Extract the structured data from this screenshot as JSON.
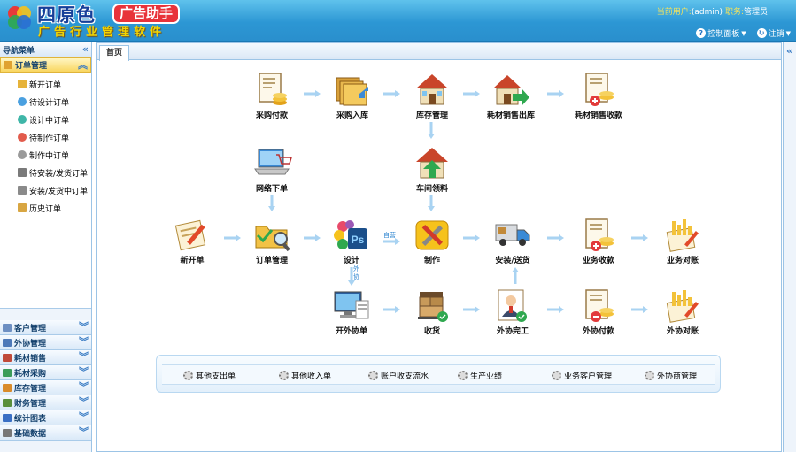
{
  "brand": {
    "main": "四原色",
    "badge": "广告助手",
    "sub": "广告行业管理软件"
  },
  "user": {
    "current_label": "当前用户:",
    "current_value": "(admin)",
    "role_label": "职务:",
    "role_value": "管理员"
  },
  "top_nav": {
    "control_panel": "控制面板",
    "logout": "注销"
  },
  "sidebar": {
    "title": "导航菜单",
    "active_group": "订单管理",
    "order_items": [
      "新开订单",
      "待设计订单",
      "设计中订单",
      "待制作订单",
      "制作中订单",
      "待安装/发货订单",
      "安装/发货中订单",
      "历史订单"
    ],
    "groups": [
      "客户管理",
      "外协管理",
      "耗材销售",
      "耗材采购",
      "库存管理",
      "财务管理",
      "统计图表",
      "基础数据"
    ]
  },
  "tabs": {
    "home": "首页"
  },
  "flow": {
    "purchase_pay": "采购付款",
    "purchase_in": "采购入库",
    "inventory": "库存管理",
    "consumable_out": "耗材销售出库",
    "consumable_collect": "耗材销售收款",
    "online_order": "网络下单",
    "workshop_material": "车间领料",
    "new_order": "新开单",
    "order_mgmt": "订单管理",
    "design": "设计",
    "produce": "制作",
    "install": "安装/送货",
    "biz_collect": "业务收款",
    "biz_reconcile": "业务对账",
    "outsource_order": "开外协单",
    "receive": "收货",
    "outsource_done": "外协完工",
    "outsource_pay": "外协付款",
    "outsource_reconcile": "外协对账",
    "self_made_label": "自营",
    "outsource_label": "外协"
  },
  "bottom_links": [
    "其他支出单",
    "其他收入单",
    "账户收支流水",
    "生产业绩",
    "业务客户管理",
    "外协商管理"
  ],
  "colors": {
    "header_top": "#5fc2ec",
    "header_bottom": "#2a8fcd",
    "active_group": "#f9d660",
    "arrow": "#a9d3f2"
  }
}
